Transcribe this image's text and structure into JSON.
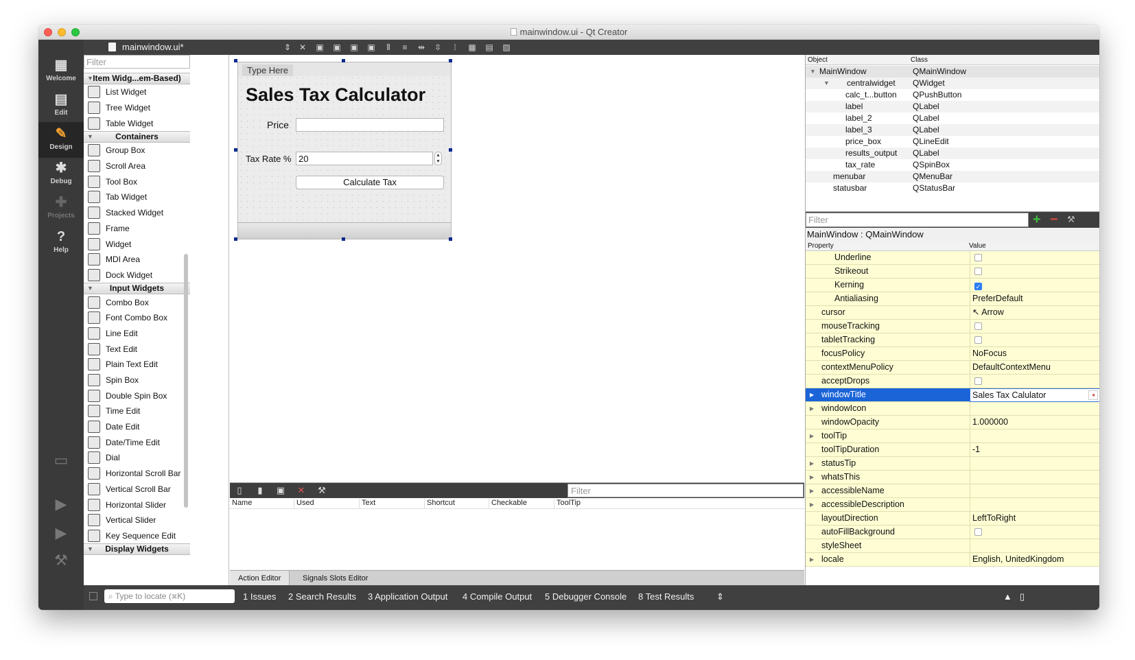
{
  "window": {
    "title": "mainwindow.ui - Qt Creator"
  },
  "modes": [
    {
      "label": "Welcome",
      "icon": "grid-icon"
    },
    {
      "label": "Edit",
      "icon": "document-icon"
    },
    {
      "label": "Design",
      "icon": "pencil-icon"
    },
    {
      "label": "Debug",
      "icon": "bug-icon"
    },
    {
      "label": "Projects",
      "icon": "wrench-icon"
    },
    {
      "label": "Help",
      "icon": "help-icon"
    }
  ],
  "toolbar": {
    "file_name": "mainwindow.ui*"
  },
  "widgetbox": {
    "filter_placeholder": "Filter",
    "cat_item_views": "Item Widg...em-Based)",
    "cat_containers": "Containers",
    "cat_input": "Input Widgets",
    "cat_display": "Display Widgets",
    "item_based": [
      "List Widget",
      "Tree Widget",
      "Table Widget"
    ],
    "containers": [
      "Group Box",
      "Scroll Area",
      "Tool Box",
      "Tab Widget",
      "Stacked Widget",
      "Frame",
      "Widget",
      "MDI Area",
      "Dock Widget"
    ],
    "inputs": [
      "Combo Box",
      "Font Combo Box",
      "Line Edit",
      "Text Edit",
      "Plain Text Edit",
      "Spin Box",
      "Double Spin Box",
      "Time Edit",
      "Date Edit",
      "Date/Time Edit",
      "Dial",
      "Horizontal Scroll Bar",
      "Vertical Scroll Bar",
      "Horizontal Slider",
      "Vertical Slider",
      "Key Sequence Edit"
    ]
  },
  "form": {
    "menu_placeholder": "Type Here",
    "title": "Sales Tax Calculator",
    "price_label": "Price",
    "price_value": "",
    "tax_label": "Tax Rate %",
    "tax_value": "20",
    "button_label": "Calculate Tax"
  },
  "action_editor": {
    "filter_placeholder": "Filter",
    "columns": [
      "Name",
      "Used",
      "Text",
      "Shortcut",
      "Checkable",
      "ToolTip"
    ],
    "tab_action": "Action Editor",
    "tab_signals": "Signals  Slots Editor"
  },
  "object_inspector": {
    "col_object": "Object",
    "col_class": "Class",
    "rows": [
      {
        "object": "MainWindow",
        "class": "QMainWindow"
      },
      {
        "object": "centralwidget",
        "class": "QWidget"
      },
      {
        "object": "calc_t...button",
        "class": "QPushButton"
      },
      {
        "object": "label",
        "class": "QLabel"
      },
      {
        "object": "label_2",
        "class": "QLabel"
      },
      {
        "object": "label_3",
        "class": "QLabel"
      },
      {
        "object": "price_box",
        "class": "QLineEdit"
      },
      {
        "object": "results_output",
        "class": "QLabel"
      },
      {
        "object": "tax_rate",
        "class": "QSpinBox"
      },
      {
        "object": "menubar",
        "class": "QMenuBar"
      },
      {
        "object": "statusbar",
        "class": "QStatusBar"
      }
    ]
  },
  "property_editor": {
    "filter_placeholder": "Filter",
    "object_line": "MainWindow : QMainWindow",
    "col_property": "Property",
    "col_value": "Value",
    "rows": [
      {
        "name": "Underline",
        "value": "",
        "type": "check",
        "checked": false,
        "indent": true
      },
      {
        "name": "Strikeout",
        "value": "",
        "type": "check",
        "checked": false,
        "indent": true
      },
      {
        "name": "Kerning",
        "value": "",
        "type": "check",
        "checked": true,
        "indent": true
      },
      {
        "name": "Antialiasing",
        "value": "PreferDefault",
        "type": "text",
        "indent": true
      },
      {
        "name": "cursor",
        "value": "Arrow",
        "type": "text"
      },
      {
        "name": "mouseTracking",
        "value": "",
        "type": "check",
        "checked": false
      },
      {
        "name": "tabletTracking",
        "value": "",
        "type": "check",
        "checked": false
      },
      {
        "name": "focusPolicy",
        "value": "NoFocus",
        "type": "text"
      },
      {
        "name": "contextMenuPolicy",
        "value": "DefaultContextMenu",
        "type": "text"
      },
      {
        "name": "acceptDrops",
        "value": "",
        "type": "check",
        "checked": false
      },
      {
        "name": "windowTitle",
        "value": "Sales Tax Calulator",
        "type": "text",
        "expandable": true,
        "selected": true
      },
      {
        "name": "windowIcon",
        "value": "",
        "type": "text",
        "expandable": true
      },
      {
        "name": "windowOpacity",
        "value": "1.000000",
        "type": "text"
      },
      {
        "name": "toolTip",
        "value": "",
        "type": "text",
        "expandable": true
      },
      {
        "name": "toolTipDuration",
        "value": "-1",
        "type": "text"
      },
      {
        "name": "statusTip",
        "value": "",
        "type": "text",
        "expandable": true
      },
      {
        "name": "whatsThis",
        "value": "",
        "type": "text",
        "expandable": true
      },
      {
        "name": "accessibleName",
        "value": "",
        "type": "text",
        "expandable": true
      },
      {
        "name": "accessibleDescription",
        "value": "",
        "type": "text",
        "expandable": true
      },
      {
        "name": "layoutDirection",
        "value": "LeftToRight",
        "type": "text"
      },
      {
        "name": "autoFillBackground",
        "value": "",
        "type": "check",
        "checked": false
      },
      {
        "name": "styleSheet",
        "value": "",
        "type": "text"
      },
      {
        "name": "locale",
        "value": "English, UnitedKingdom",
        "type": "text",
        "expandable": true
      }
    ]
  },
  "statusbar": {
    "locate_placeholder": "Type to locate (⌘K)",
    "panes": [
      "1  Issues",
      "2  Search Results",
      "3  Application Output",
      "4  Compile Output",
      "5  Debugger Console",
      "8  Test Results"
    ]
  }
}
